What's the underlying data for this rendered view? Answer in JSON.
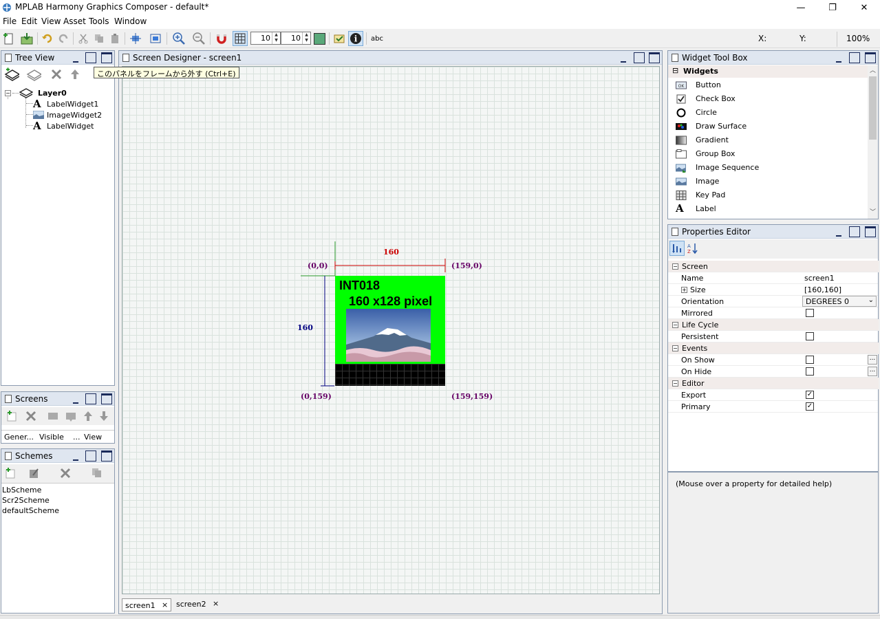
{
  "window": {
    "title": "MPLAB Harmony Graphics Composer - default*",
    "minimize_glyph": "—",
    "maximize_glyph": "❐",
    "close_glyph": "✕"
  },
  "menu": [
    "File",
    "Edit",
    "View",
    "Asset",
    "Tools",
    "Window"
  ],
  "toolbar": {
    "grid_x": "10",
    "grid_y": "10",
    "abc_label": "abc",
    "x_label": "X:",
    "y_label": "Y:",
    "zoom": "100%"
  },
  "tree_view": {
    "title": "Tree View",
    "tooltip": "このパネルをフレームから外す (Ctrl+E)",
    "items": [
      {
        "label": "Layer0",
        "icon": "layer-icon"
      },
      {
        "label": "LabelWidget1",
        "icon": "label-a-icon"
      },
      {
        "label": "ImageWidget2",
        "icon": "image-icon"
      },
      {
        "label": "LabelWidget",
        "icon": "label-a-icon"
      }
    ]
  },
  "screens_panel": {
    "title": "Screens",
    "columns": [
      "Gener...",
      "Visible",
      "...",
      "View"
    ]
  },
  "schemes_panel": {
    "title": "Schemes",
    "items": [
      "LbScheme",
      "Scr2Scheme",
      "defaultScheme"
    ]
  },
  "designer": {
    "title": "Screen Designer - screen1",
    "width_label": "160",
    "height_label": "160",
    "corner_tl": "(0,0)",
    "corner_tr": "(159,0)",
    "corner_bl": "(0,159)",
    "corner_br": "(159,159)",
    "screen_text_line1": "INT018",
    "screen_text_line2": "160 x128 pixel",
    "tabs": [
      "screen1",
      "screen2"
    ],
    "tab_close": "×",
    "colors": {
      "screen_bg": "#00ff00",
      "bottom_band": "#000000",
      "width_dim": "#cc0000",
      "height_dim": "#000080",
      "corner_text": "#660066"
    }
  },
  "widget_toolbox": {
    "title": "Widget Tool Box",
    "category": "Widgets",
    "items": [
      {
        "label": "Button",
        "icon": "button-ok-icon"
      },
      {
        "label": "Check Box",
        "icon": "checkbox-icon"
      },
      {
        "label": "Circle",
        "icon": "circle-icon"
      },
      {
        "label": "Draw Surface",
        "icon": "draw-surface-icon"
      },
      {
        "label": "Gradient",
        "icon": "gradient-icon"
      },
      {
        "label": "Group Box",
        "icon": "group-box-icon"
      },
      {
        "label": "Image Sequence",
        "icon": "image-sequence-icon"
      },
      {
        "label": "Image",
        "icon": "image-icon"
      },
      {
        "label": "Key Pad",
        "icon": "keypad-icon"
      },
      {
        "label": "Label",
        "icon": "label-a-icon"
      }
    ]
  },
  "properties": {
    "title": "Properties Editor",
    "rows": [
      {
        "type": "group",
        "name": "Screen"
      },
      {
        "type": "text",
        "name": "Name",
        "value": "screen1"
      },
      {
        "type": "expand",
        "name": "Size",
        "value": "[160,160]"
      },
      {
        "type": "combo",
        "name": "Orientation",
        "value": "DEGREES 0"
      },
      {
        "type": "check",
        "name": "Mirrored",
        "checked": false
      },
      {
        "type": "group",
        "name": "Life Cycle"
      },
      {
        "type": "check",
        "name": "Persistent",
        "checked": false
      },
      {
        "type": "group",
        "name": "Events"
      },
      {
        "type": "check-dots",
        "name": "On Show",
        "checked": false
      },
      {
        "type": "check-dots",
        "name": "On Hide",
        "checked": false
      },
      {
        "type": "group",
        "name": "Editor"
      },
      {
        "type": "check",
        "name": "Export",
        "checked": true
      },
      {
        "type": "check",
        "name": "Primary",
        "checked": true
      }
    ],
    "help_text": "(Mouse over a property for detailed help)"
  }
}
